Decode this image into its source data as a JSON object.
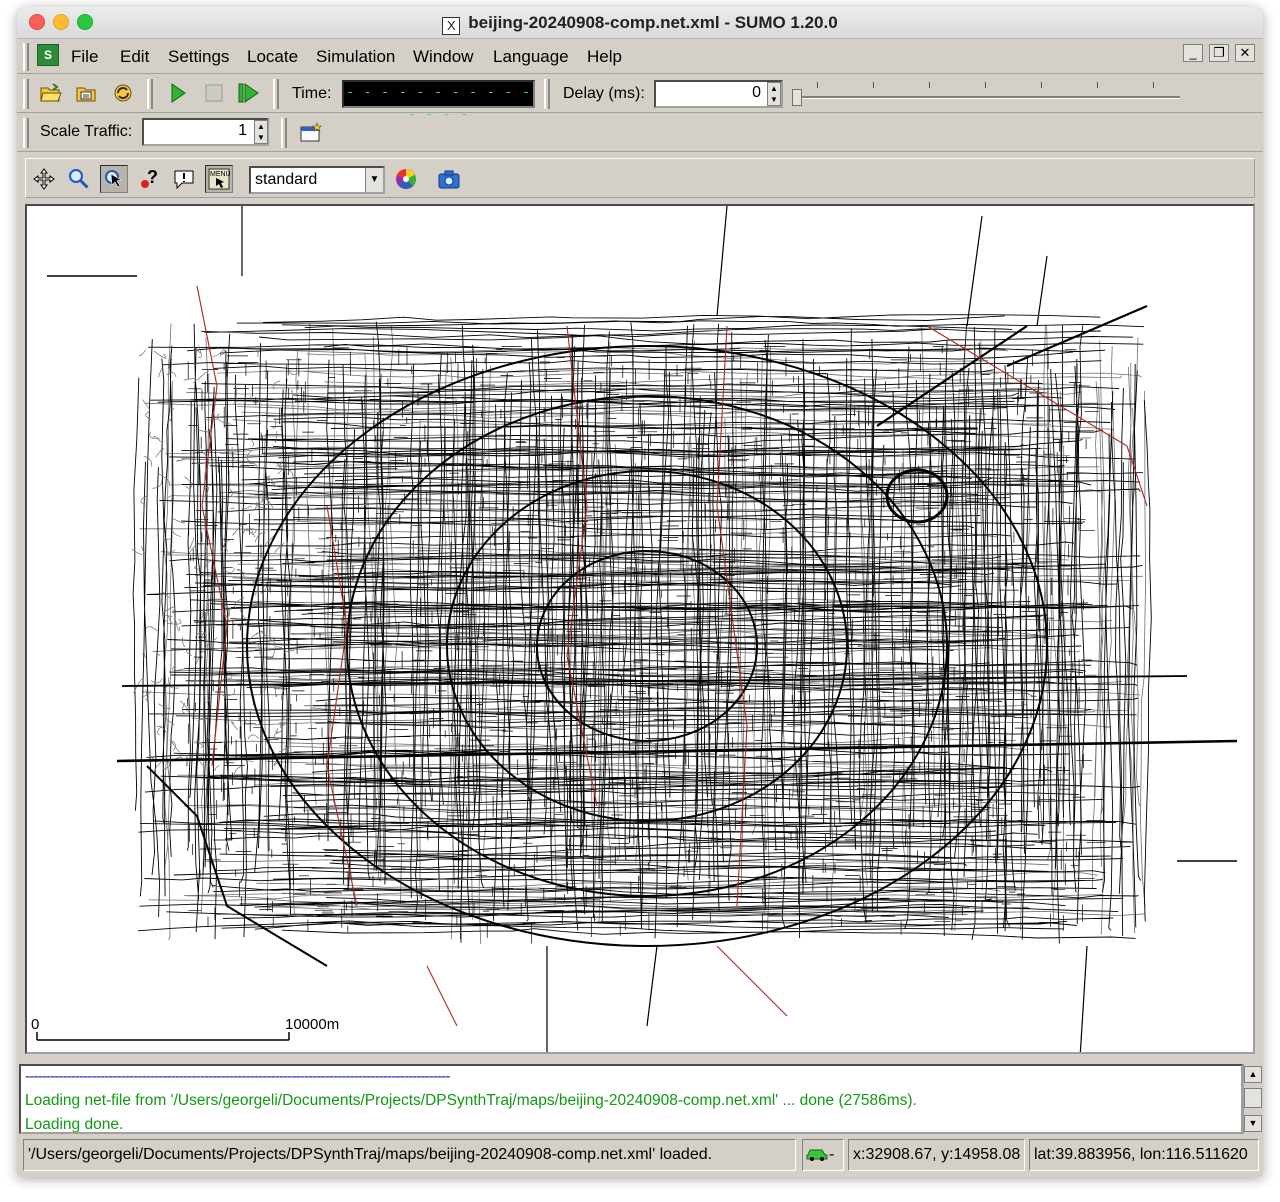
{
  "window": {
    "x_logo": "X",
    "title": "beijing-20240908-comp.net.xml - SUMO 1.20.0"
  },
  "menu": {
    "items": [
      "File",
      "Edit",
      "Settings",
      "Locate",
      "Simulation",
      "Window",
      "Language",
      "Help"
    ],
    "mdi": {
      "minimize": "_",
      "restore": "❐",
      "close": "✕"
    }
  },
  "toolbar": {
    "time_label": "Time:",
    "time_value": "- - - - - - - - - - - - - - -",
    "delay_label": "Delay (ms):",
    "delay_value": "0",
    "scale_label": "Scale Traffic:",
    "scale_value": "1"
  },
  "view": {
    "scheme": "standard"
  },
  "map": {
    "scale_start": "0",
    "scale_end": "10000m",
    "colors": {
      "road": "#000000",
      "minor_road": "#6e6e6e",
      "rail": "#b22222"
    }
  },
  "messages": {
    "separator": "------------------------------------------------------------------------------------------------------",
    "loading": "Loading net-file from '/Users/georgeli/Documents/Projects/DPSynthTraj/maps/beijing-20240908-comp.net.xml' ... done (27586ms).",
    "done": "Loading done."
  },
  "status": {
    "message": "'/Users/georgeli/Documents/Projects/DPSynthTraj/maps/beijing-20240908-comp.net.xml' loaded.",
    "car_suffix": "-",
    "coords": "x:32908.67, y:14958.08",
    "geo": "lat:39.883956, lon:116.511620"
  }
}
